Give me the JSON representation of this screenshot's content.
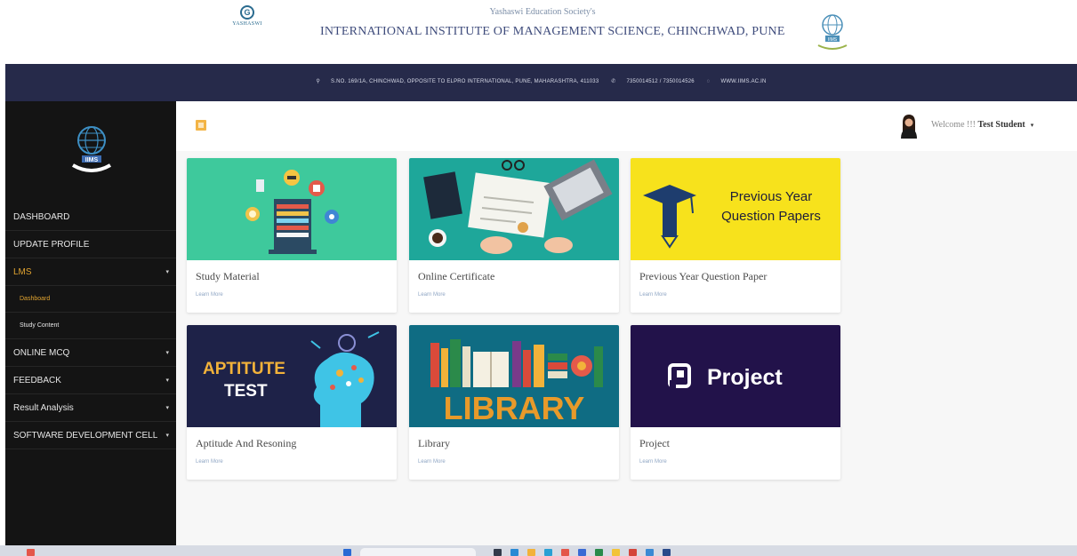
{
  "header": {
    "yashaswi_logo_text": "YASHASWI",
    "society": "Yashaswi Education Society's",
    "institute": "INTERNATIONAL INSTITUTE OF MANAGEMENT SCIENCE, CHINCHWAD, PUNE",
    "logo_text": "IIMS"
  },
  "address_bar": {
    "address": "S.NO. 169/1A, CHINCHWAD, OPPOSITE TO ELPRO INTERNATIONAL, PUNE, MAHARASHTRA, 411033",
    "phone": "7350014512 / 7350014526",
    "website": "WWW.IIMS.AC.IN"
  },
  "sidebar": {
    "logo_text": "IIMS",
    "items": [
      {
        "label": "DASHBOARD",
        "caret": ""
      },
      {
        "label": "UPDATE PROFILE",
        "caret": ""
      },
      {
        "label": "LMS",
        "caret": "▾"
      },
      {
        "label": "Dashboard",
        "caret": ""
      },
      {
        "label": "Study Content",
        "caret": ""
      },
      {
        "label": "ONLINE MCQ",
        "caret": "▾"
      },
      {
        "label": "FEEDBACK",
        "caret": "▾"
      },
      {
        "label": "Result Analysis",
        "caret": "▾"
      },
      {
        "label": "SOFTWARE DEVELOPMENT CELL",
        "caret": "▾"
      }
    ]
  },
  "topbar": {
    "welcome_prefix": "Welcome !!! ",
    "user_name": "Test Student",
    "dropdown_caret": "▾"
  },
  "cards": [
    {
      "title": "Study Material",
      "link": "Learn More"
    },
    {
      "title": "Online Certificate",
      "link": "Learn More"
    },
    {
      "title": "Previous Year Question Paper",
      "link": "Learn More",
      "banner": "Previous Year Question Papers"
    },
    {
      "title": "Aptitude And Resoning",
      "link": "Learn More",
      "banner_line1": "APTITUTE",
      "banner_line2": "TEST"
    },
    {
      "title": "Library",
      "link": "Learn More",
      "banner": "LIBRARY"
    },
    {
      "title": "Project",
      "link": "Learn More",
      "banner": "Project"
    }
  ],
  "colors": {
    "address_bar": "#262a4a",
    "sidebar": "#141414",
    "active_menu": "#e0a330",
    "study_bg": "#3ec99c",
    "cert_bg": "#1ea79a",
    "pyq_bg": "#f7e21c",
    "aptitude_bg": "#1e2248",
    "library_bg": "#0f6c83",
    "project_bg": "#22124a"
  }
}
